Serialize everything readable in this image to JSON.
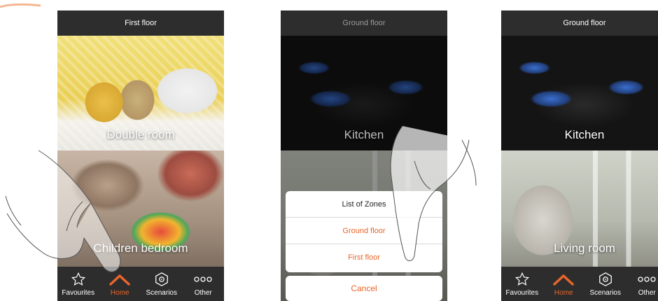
{
  "colors": {
    "accent": "#e8662b",
    "bar": "#2d2d2d",
    "white": "#ffffff"
  },
  "screens": [
    {
      "title": "First floor",
      "rooms": [
        {
          "label": "Double room"
        },
        {
          "label": "Children bedroom"
        }
      ],
      "tabs": [
        {
          "label": "Favourites",
          "icon": "star-icon",
          "active": false
        },
        {
          "label": "Home",
          "icon": "home-icon",
          "active": true
        },
        {
          "label": "Scenarios",
          "icon": "scenarios-icon",
          "active": false
        },
        {
          "label": "Other",
          "icon": "more-icon",
          "active": false
        }
      ]
    },
    {
      "title": "Ground floor",
      "rooms": [
        {
          "label": "Kitchen"
        }
      ],
      "zone_picker": {
        "header": "List of Zones",
        "options": [
          "Ground floor",
          "First floor"
        ],
        "cancel": "Cancel"
      }
    },
    {
      "title": "Ground floor",
      "rooms": [
        {
          "label": "Kitchen"
        },
        {
          "label": "Living room"
        }
      ],
      "tabs": [
        {
          "label": "Favourites",
          "icon": "star-icon",
          "active": false
        },
        {
          "label": "Home",
          "icon": "home-icon",
          "active": true
        },
        {
          "label": "Scenarios",
          "icon": "scenarios-icon",
          "active": false
        },
        {
          "label": "Other",
          "icon": "more-icon",
          "active": false
        }
      ]
    }
  ]
}
